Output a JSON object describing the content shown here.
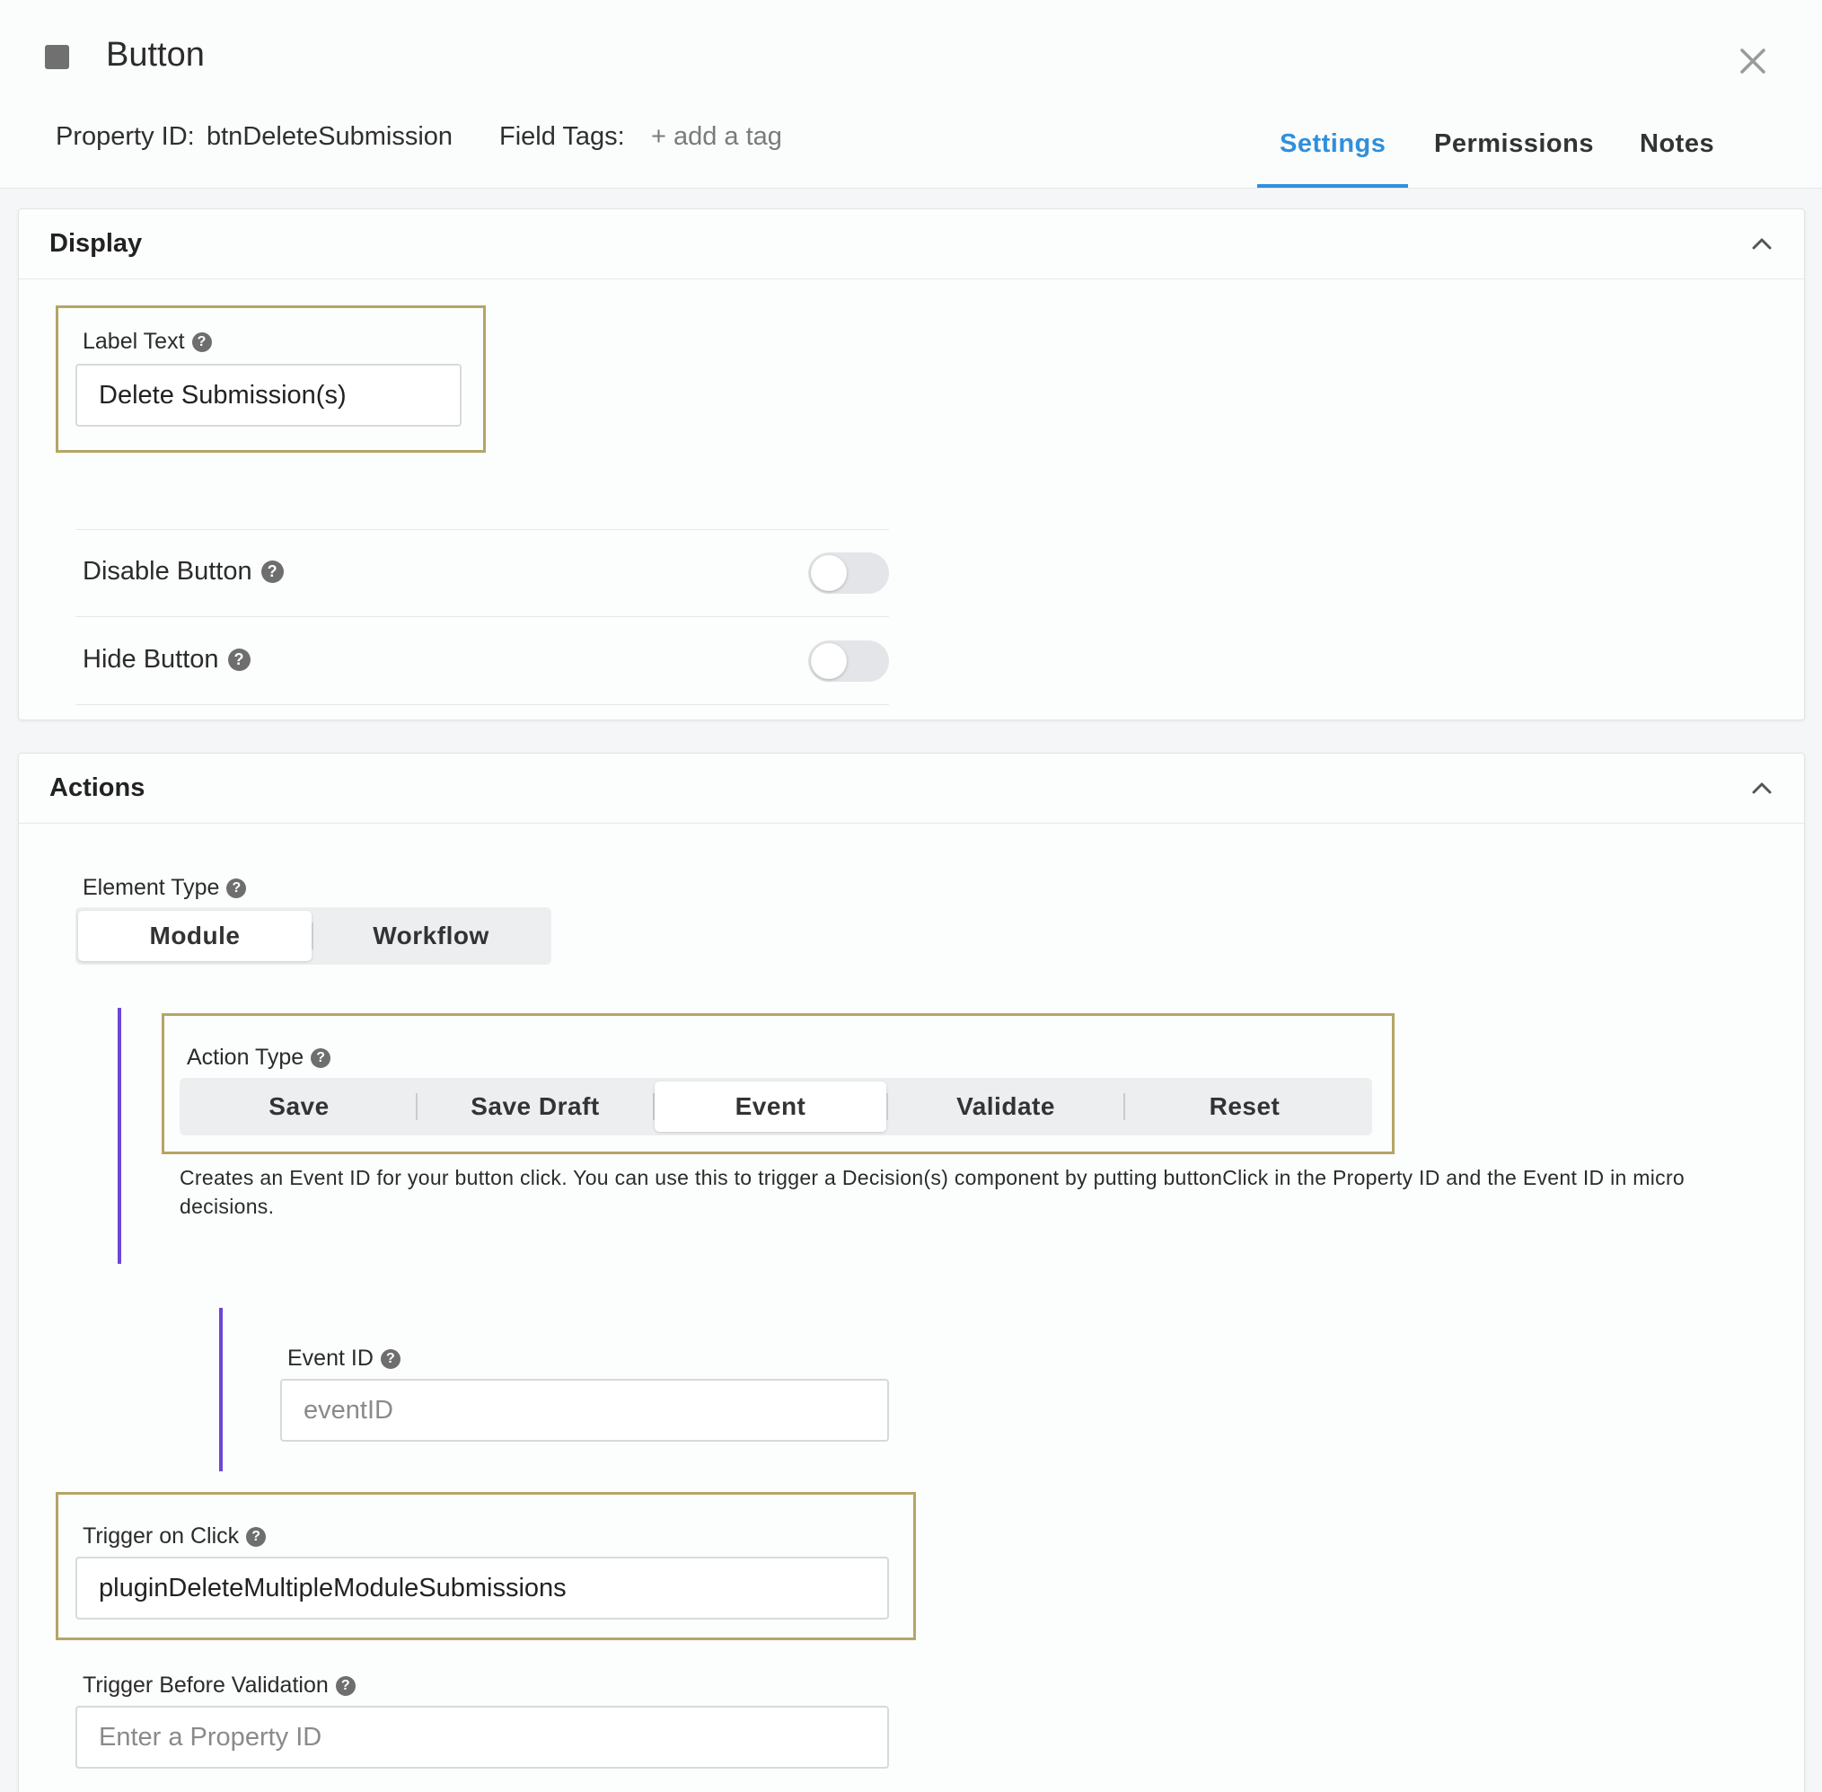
{
  "header": {
    "title": "Button",
    "property_id_label": "Property ID:",
    "property_id_value": "btnDeleteSubmission",
    "field_tags_label": "Field Tags:",
    "add_tag": "+ add a tag",
    "tabs": [
      {
        "label": "Settings",
        "active": true
      },
      {
        "label": "Permissions",
        "active": false
      },
      {
        "label": "Notes",
        "active": false
      }
    ]
  },
  "display": {
    "title": "Display",
    "label_text": {
      "label": "Label Text",
      "value": "Delete Submission(s)"
    },
    "disable_button": {
      "label": "Disable Button",
      "on": false
    },
    "hide_button": {
      "label": "Hide Button",
      "on": false
    }
  },
  "actions": {
    "title": "Actions",
    "element_type": {
      "label": "Element Type",
      "options": [
        "Module",
        "Workflow"
      ],
      "selected": "Module"
    },
    "action_type": {
      "label": "Action Type",
      "options": [
        "Save",
        "Save Draft",
        "Event",
        "Validate",
        "Reset"
      ],
      "selected": "Event",
      "description": "Creates an Event ID for your button click. You can use this to trigger a Decision(s) component by putting buttonClick in the Property ID and the Event ID in micro decisions."
    },
    "event_id": {
      "label": "Event ID",
      "value": "",
      "placeholder": "eventID"
    },
    "trigger_on_click": {
      "label": "Trigger on Click",
      "value": "pluginDeleteMultipleModuleSubmissions"
    },
    "trigger_before_validation": {
      "label": "Trigger Before Validation",
      "value": "",
      "placeholder": "Enter a Property ID"
    }
  },
  "colors": {
    "accent": "#2f8fdc",
    "highlight_border": "#b5a566",
    "nested_bar": "#6b48d6"
  },
  "icons": {
    "type": "square-icon",
    "close": "close-icon",
    "collapse": "chevron-up-icon",
    "help": "question-circle-icon"
  }
}
